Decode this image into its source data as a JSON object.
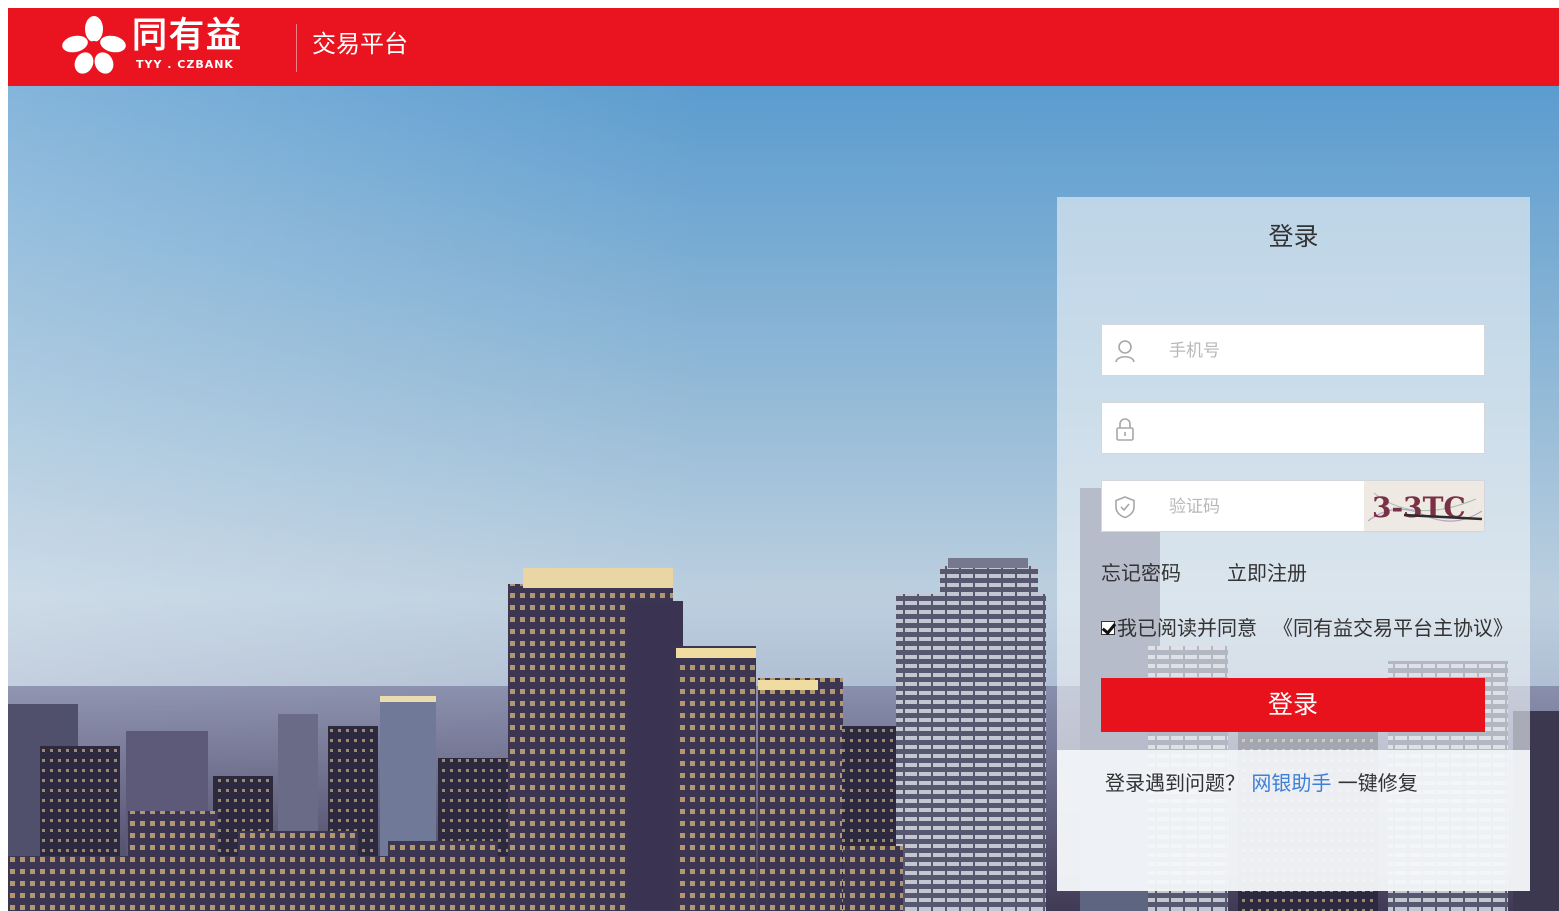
{
  "header": {
    "brand_cn": "同有益",
    "brand_en": "TYY . CZBANK",
    "subtitle": "交易平台",
    "background": "#e9141f"
  },
  "login": {
    "title": "登录",
    "phone_placeholder": "手机号",
    "password_placeholder": "",
    "captcha_placeholder": "验证码",
    "captcha_text": "3-3TC",
    "forgot_password": "忘记密码",
    "register": "立即注册",
    "agree_checked": true,
    "agree_text": "我已阅读并同意",
    "protocol_link": "《同有益交易平台主协议》",
    "submit": "登录",
    "help_question": "登录遇到问题？",
    "help_link": "网银助手",
    "help_suffix": "一键修复",
    "accent": "#e8121c",
    "link_color": "#3f7fd6"
  },
  "icons": {
    "logo": "tyy-logo-mark",
    "phone_field": "user-icon",
    "password_field": "lock-icon",
    "captcha_field": "shield-icon"
  }
}
